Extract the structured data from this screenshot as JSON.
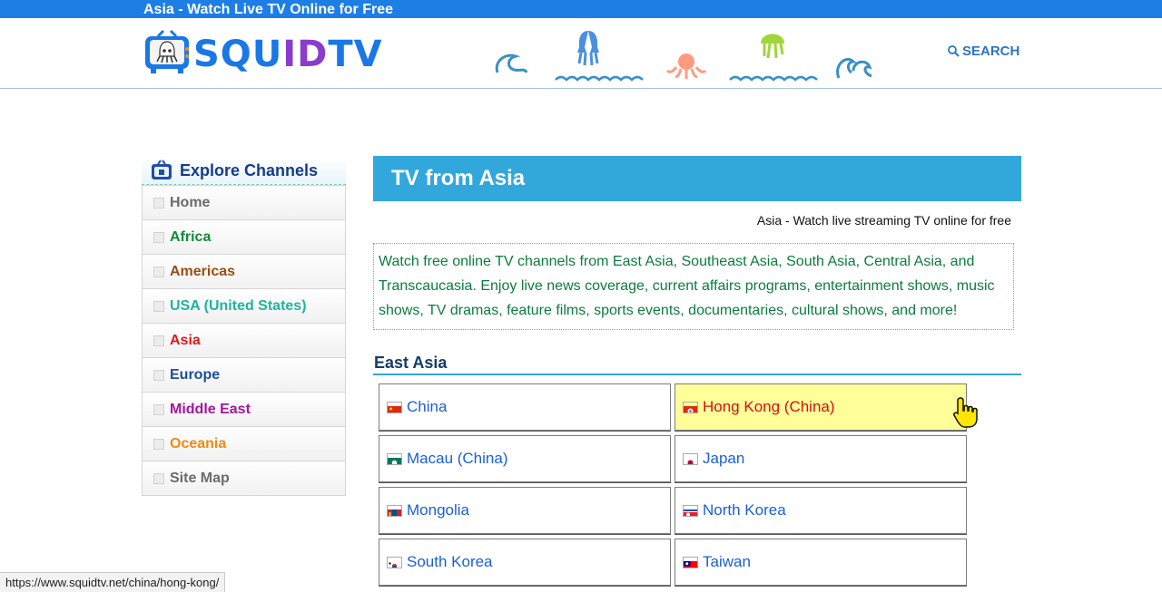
{
  "top_bar": {
    "title": "Asia - Watch Live TV Online for Free"
  },
  "header": {
    "logo_left": "SQU",
    "logo_mid": "ID",
    "logo_right": "TV",
    "search_label": "SEARCH"
  },
  "sidebar": {
    "heading": "Explore Channels",
    "items": [
      {
        "label": "Home",
        "color": "#6b6b6b"
      },
      {
        "label": "Africa",
        "color": "#118a3a"
      },
      {
        "label": "Americas",
        "color": "#9a4e12"
      },
      {
        "label": "USA (United States)",
        "color": "#21b3a0"
      },
      {
        "label": "Asia",
        "color": "#e01a1a"
      },
      {
        "label": "Europe",
        "color": "#1b4f9c"
      },
      {
        "label": "Middle East",
        "color": "#a3179e"
      },
      {
        "label": "Oceania",
        "color": "#ee8a12"
      },
      {
        "label": "Site Map",
        "color": "#6b6b6b"
      }
    ]
  },
  "main": {
    "banner": "TV from Asia",
    "subtitle": "Asia - Watch live streaming TV online for free",
    "intro": "Watch free online TV channels from East Asia, Southeast Asia, South Asia, Central Asia, and Transcaucasia. Enjoy live news coverage, current affairs programs, entertainment shows, music shows, TV dramas, feature films, sports events, documentaries, cultural shows, and more!",
    "section_title": "East Asia",
    "countries": [
      {
        "label": "China",
        "flag": "china-flag-icon"
      },
      {
        "label": "Hong Kong (China)",
        "flag": "hong-kong-flag-icon"
      },
      {
        "label": "Macau (China)",
        "flag": "macau-flag-icon"
      },
      {
        "label": "Japan",
        "flag": "japan-flag-icon"
      },
      {
        "label": "Mongolia",
        "flag": "mongolia-flag-icon"
      },
      {
        "label": "North Korea",
        "flag": "north-korea-flag-icon"
      },
      {
        "label": "South Korea",
        "flag": "south-korea-flag-icon"
      },
      {
        "label": "Taiwan",
        "flag": "taiwan-flag-icon"
      }
    ]
  },
  "status_bar": {
    "url": "https://www.squidtv.net/china/hong-kong/"
  },
  "colors": {
    "top_bar": "#1d7ee6",
    "banner": "#32a7dc",
    "intro_text": "#0c7c3d",
    "link": "#1b5fd6",
    "hover_bg": "#fffe99",
    "hover_text": "#d81010"
  }
}
